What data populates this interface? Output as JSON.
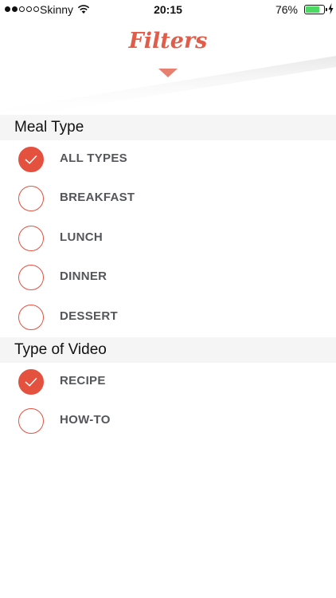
{
  "status_bar": {
    "carrier": "Skinny",
    "time": "20:15",
    "battery_percent": "76%",
    "battery_level": 0.76,
    "signal_bars_filled": 2,
    "signal_bars_total": 5
  },
  "header": {
    "title": "Filters",
    "accent_color": "#e15d4a"
  },
  "sections": [
    {
      "title": "Meal Type",
      "options": [
        {
          "label": "ALL TYPES",
          "checked": true
        },
        {
          "label": "BREAKFAST",
          "checked": false
        },
        {
          "label": "LUNCH",
          "checked": false
        },
        {
          "label": "DINNER",
          "checked": false
        },
        {
          "label": "DESSERT",
          "checked": false
        }
      ]
    },
    {
      "title": "Type of Video",
      "options": [
        {
          "label": "RECIPE",
          "checked": true
        },
        {
          "label": "HOW-TO",
          "checked": false
        }
      ]
    }
  ]
}
